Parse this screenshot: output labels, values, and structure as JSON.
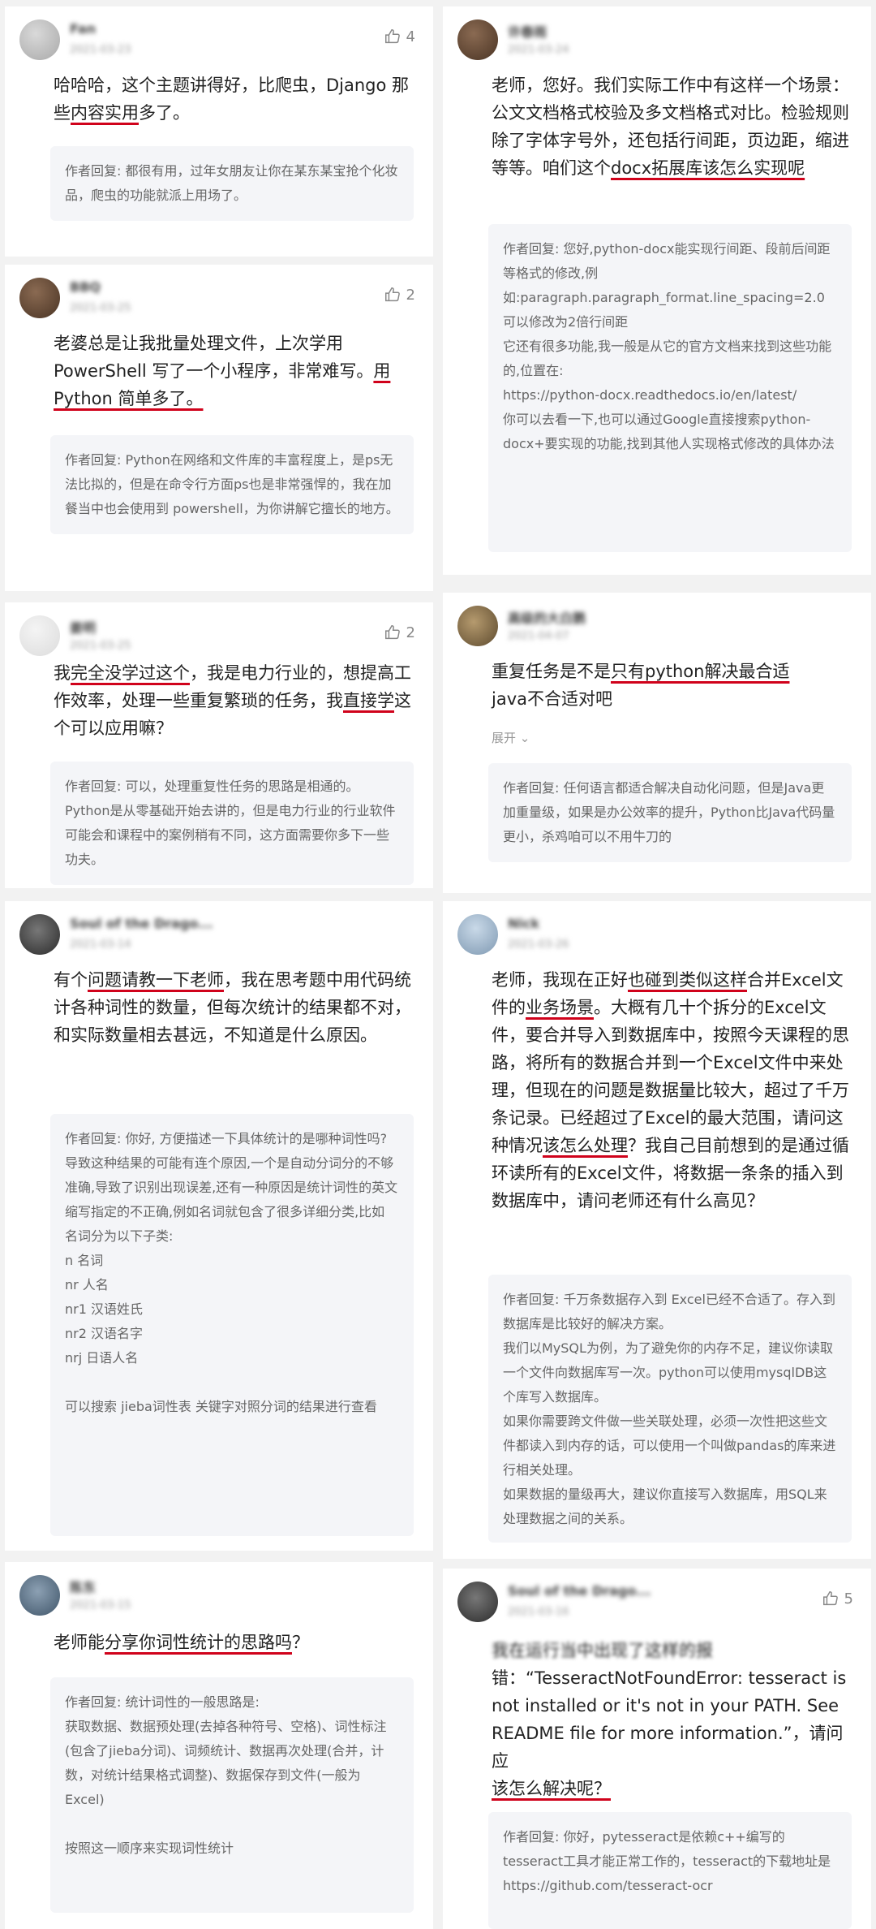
{
  "comments": [
    {
      "id": "c1",
      "username": "Fan",
      "date": "2021-03-23",
      "likes": "4",
      "text_parts": [
        "哈哈哈，这个主题讲得好，比爬虫，Django 那些",
        "内容实用",
        "多了。"
      ],
      "reply_lines": [
        "作者回复: 都很有用，过年女朋友让你在某东某宝抢个化妆品，爬虫的功能就派上用场了。"
      ]
    },
    {
      "id": "c2",
      "username": "许春雨",
      "date": "2021-03-24",
      "likes": "",
      "text_parts": [
        "老师，您好。我们实际工作中有这样一个场景：公文文档格式校验及多文档格式对比。检验规则除了字体字号外，还包括行间距，页边距，缩进等等。咱们这个",
        "docx拓展库该怎么实现呢",
        ""
      ],
      "reply_lines": [
        "作者回复: 您好,python-docx能实现行间距、段前后间距等格式的修改,例",
        "如:paragraph.paragraph_format.line_spacing=2.0",
        "可以修改为2倍行间距",
        "它还有很多功能,我一般是从它的官方文档来找到这些功能的,位置在:",
        "https://python-docx.readthedocs.io/en/latest/",
        "你可以去看一下,也可以通过Google直接搜索python-docx+要实现的功能,找到其他人实现格式修改的具体办法"
      ]
    },
    {
      "id": "c3",
      "username": "BBQ",
      "date": "2021-03-25",
      "likes": "2",
      "text_parts": [
        "老婆总是让我批量处理文件，上次学用 PowerShell 写了一个小程序，非常难写。",
        "用 Python 简单多了。",
        ""
      ],
      "reply_lines": [
        "作者回复: Python在网络和文件库的丰富程度上，是ps无法比拟的，但是在命令行方面ps也是非常强悍的，我在加餐当中也会使用到 powershell，为你讲解它擅长的地方。"
      ]
    },
    {
      "id": "c4",
      "username": "高级的大白鹅",
      "date": "2021-04-07",
      "likes": "",
      "text_parts": [
        "重复任务是不是",
        "只有python解决最合适",
        "java不合适对吧"
      ],
      "expand": "展开 ⌄",
      "reply_lines": [
        "作者回复: 任何语言都适合解决自动化问题，但是Java更加重量级，如果是办公效率的提升，Python比Java代码量更小，杀鸡咱可以不用牛刀的"
      ]
    },
    {
      "id": "c5",
      "username": "姜明",
      "date": "2021-03-25",
      "likes": "2",
      "text_parts": [
        "我",
        "完全没学过这个",
        "，我是电力行业的，想提高工作效率，处理一些重复繁琐的任务，我",
        "直接学",
        "这个可以应用嘛？"
      ],
      "reply_lines": [
        "作者回复: 可以，处理重复性任务的思路是相通的。Python是从零基础开始去讲的，但是电力行业的行业软件可能会和课程中的案例稍有不同，这方面需要你多下一些功夫。"
      ]
    },
    {
      "id": "c6",
      "username": "Soul of the Drago...",
      "date": "2021-03-14",
      "likes": "",
      "text_parts": [
        "有个",
        "问题请教一下老师",
        "，我在思考题中用代码统计各种词性的数量，但每次统计的结果都不对，和实际数量相去甚远，不知道是什么原因。"
      ],
      "reply_lines": [
        "作者回复: 你好, 方便描述一下具体统计的是哪种词性吗? 导致这种结果的可能有连个原因,一个是自动分词分的不够准确,导致了识别出现误差,还有一种原因是统计词性的英文缩写指定的不正确,例如名词就包含了很多详细分类,比如",
        "名词分为以下子类:",
        "n 名词",
        "nr 人名",
        "nr1 汉语姓氏",
        "nr2 汉语名字",
        "nrj 日语人名",
        " ",
        "可以搜索 jieba词性表 关键字对照分词的结果进行查看"
      ]
    },
    {
      "id": "c7",
      "username": "Nick",
      "date": "2021-03-26",
      "likes": "",
      "text_parts": [
        "老师，我现在正好",
        "也碰到",
        "类似这样",
        "合并Excel文件的",
        "业务场景",
        "。大概有几十个拆分的Excel文件，要合并导入到数据库中，按照今天课程的思路，将所有的数据合并到一个Excel文件中来处理，但现在的问题是数据量比较大，超过了千万条记录。已经超过了Excel的最大范围，请问这种情况",
        "该怎么处理",
        "？我自己目前想到的是通过循环读所有的Excel文件，将数据一条条的插入到数据库中，请问老师还有什么高见？"
      ],
      "reply_lines": [
        "作者回复: 千万条数据存入到 Excel已经不合适了。存入到数据库是比较好的解决方案。",
        "我们以MySQL为例，为了避免你的内存不足，建议你读取一个文件向数据库写一次。python可以使用mysqlDB这个库写入数据库。",
        "如果你需要跨文件做一些关联处理，必须一次性把这些文件都读入到内存的话，可以使用一个叫做pandas的库来进行相关处理。",
        "如果数据的量级再大，建议你直接写入数据库，用SQL来处理数据之间的关系。"
      ]
    },
    {
      "id": "c8",
      "username": "陈东",
      "date": "2021-03-15",
      "likes": "",
      "text_parts": [
        "老师能",
        "分享你词性统计的思路吗",
        "？"
      ],
      "reply_lines": [
        "作者回复: 统计词性的一般思路是:",
        "获取数据、数据预处理(去掉各种符号、空格)、词性标注(包含了jieba分词)、词频统计、数据再次处理(合并，计数，对统计结果格式调整)、数据保存到文件(一般为Excel)",
        " ",
        "按照这一顺序来实现词性统计"
      ]
    },
    {
      "id": "c9",
      "username": "Soul of the Drago...",
      "date": "2021-03-16",
      "likes": "5",
      "text_parts": [
        "我在运行当中出现了这样的报",
        "错：“TesseractNotFoundError: tesseract is not installed or it's not in your PATH. See README file for more information.”，请问应",
        "该怎么解决呢？"
      ],
      "reply_lines": [
        "作者回复: 你好，pytesseract是依赖c++编写的tesseract工具才能正常工作的，tesseract的下载地址是",
        "https://github.com/tesseract-ocr"
      ]
    }
  ]
}
